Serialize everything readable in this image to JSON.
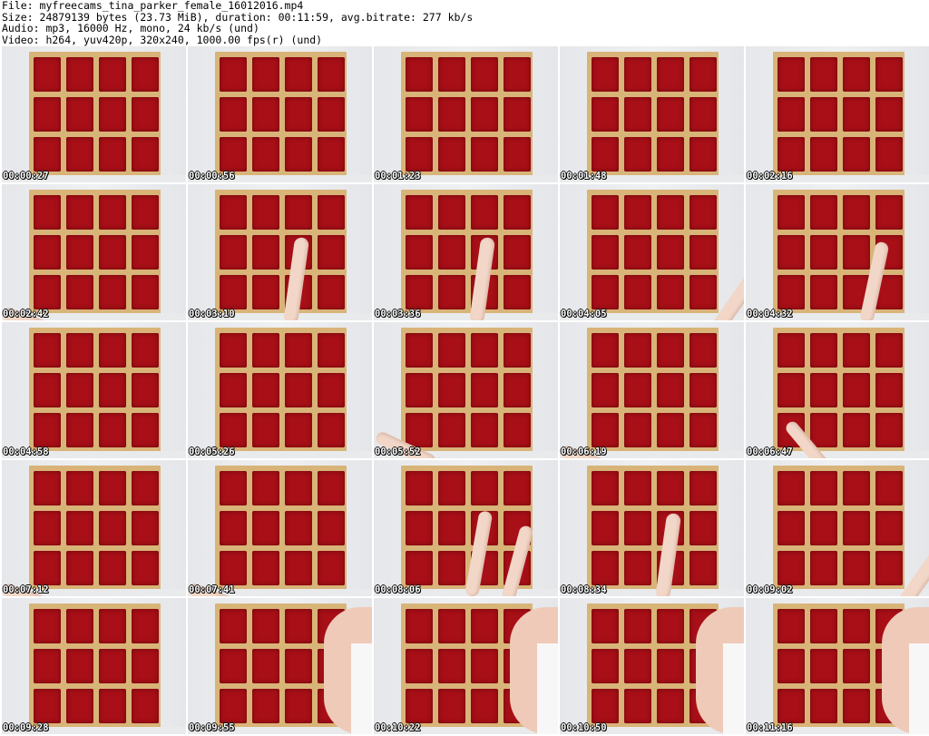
{
  "header": {
    "file": "File: myfreecams_tina_parker_female_16012016.mp4",
    "size": "Size: 24879139 bytes (23.73 MiB), duration: 00:11:59, avg.bitrate: 277 kb/s",
    "audio": "Audio: mp3, 16000 Hz, mono, 24 kb/s (und)",
    "video": "Video: h264, yuv420p, 320x240, 1000.00 fps(r) (und)"
  },
  "colors": {
    "board": "#d8b478",
    "cell": "#a80f17",
    "skin": "#f2d7c8"
  },
  "thumbs": [
    {
      "ts": "00:00:27",
      "scene": "empty"
    },
    {
      "ts": "00:00:56",
      "scene": "empty"
    },
    {
      "ts": "00:01:23",
      "scene": "empty"
    },
    {
      "ts": "00:01:48",
      "scene": "empty"
    },
    {
      "ts": "00:02:16",
      "scene": "empty"
    },
    {
      "ts": "00:02:42",
      "scene": "leg-low"
    },
    {
      "ts": "00:03:10",
      "scene": "leg-up"
    },
    {
      "ts": "00:03:36",
      "scene": "leg-up"
    },
    {
      "ts": "00:04:05",
      "scene": "leg-diag"
    },
    {
      "ts": "00:04:32",
      "scene": "leg-up-right"
    },
    {
      "ts": "00:04:58",
      "scene": "empty"
    },
    {
      "ts": "00:05:26",
      "scene": "empty"
    },
    {
      "ts": "00:05:52",
      "scene": "leg-low-mid"
    },
    {
      "ts": "00:06:19",
      "scene": "leg-low"
    },
    {
      "ts": "00:06:47",
      "scene": "leg-mid"
    },
    {
      "ts": "00:07:12",
      "scene": "leg-low"
    },
    {
      "ts": "00:07:41",
      "scene": "leg-low"
    },
    {
      "ts": "00:08:06",
      "scene": "legs-two"
    },
    {
      "ts": "00:08:34",
      "scene": "leg-up"
    },
    {
      "ts": "00:09:02",
      "scene": "leg-diag"
    },
    {
      "ts": "00:09:28",
      "scene": "empty"
    },
    {
      "ts": "00:09:55",
      "scene": "person"
    },
    {
      "ts": "00:10:22",
      "scene": "person"
    },
    {
      "ts": "00:10:50",
      "scene": "person"
    },
    {
      "ts": "00:11:16",
      "scene": "person"
    }
  ]
}
